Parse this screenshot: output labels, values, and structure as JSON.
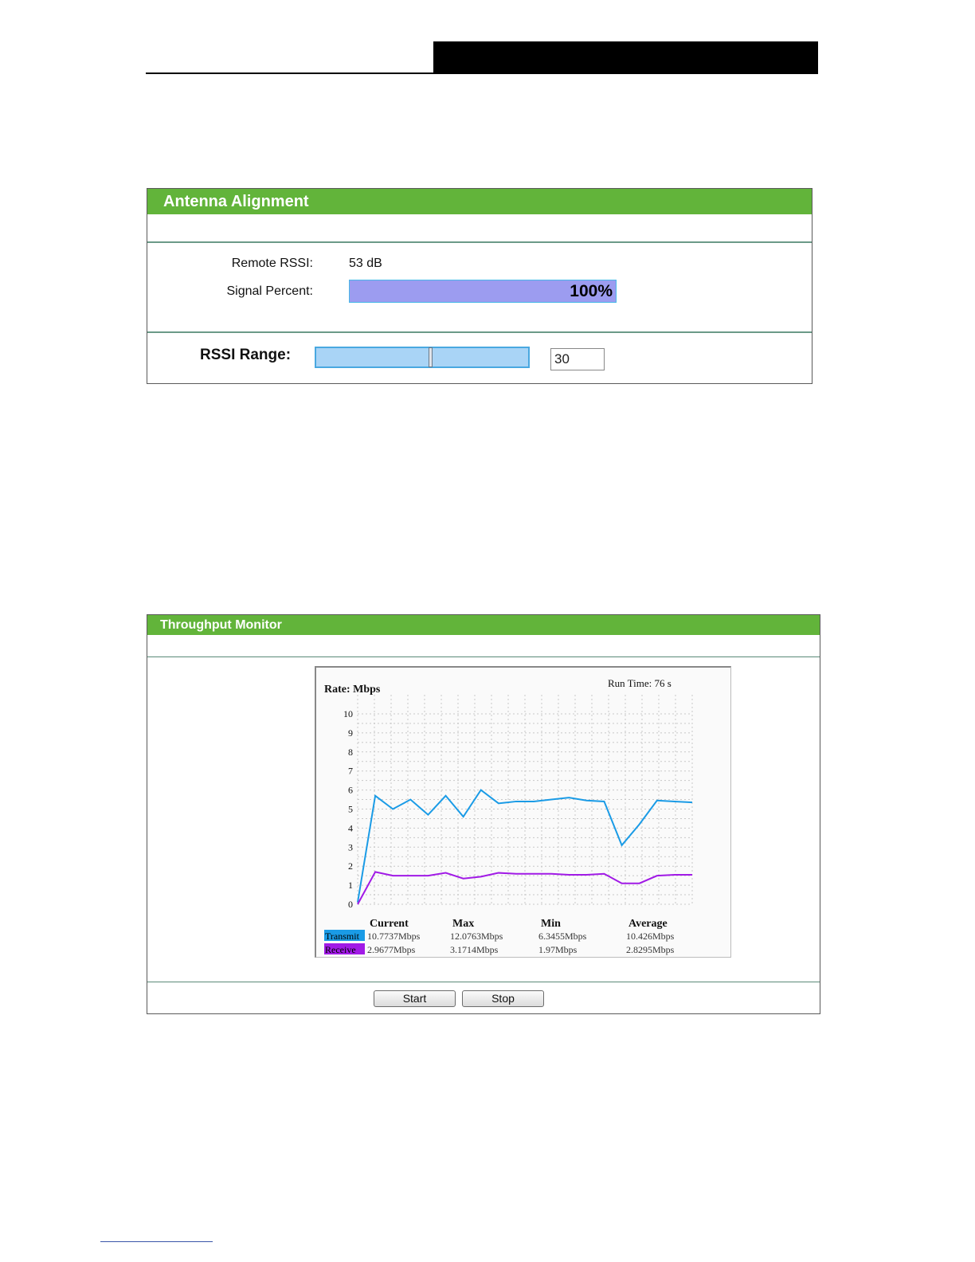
{
  "antenna": {
    "title": "Antenna Alignment",
    "remote_rssi_label": "Remote RSSI:",
    "remote_rssi_value": "53 dB",
    "signal_percent_label": "Signal Percent:",
    "signal_percent_text": "100%",
    "signal_percent_value": 100,
    "rssi_range_label": "RSSI Range:",
    "rssi_range_value": "30",
    "rssi_slider_fraction": 0.54
  },
  "throughput": {
    "title": "Throughput Monitor",
    "start_label": "Start",
    "stop_label": "Stop"
  },
  "chart_data": {
    "type": "line",
    "title": "Rate: Mbps",
    "annotation": "Run Time: 76 s",
    "ylim": [
      0,
      10
    ],
    "y_ticks": [
      "0",
      "1",
      "2",
      "3",
      "4",
      "5",
      "6",
      "7",
      "8",
      "9",
      "10"
    ],
    "grid": true,
    "x": [
      0,
      1,
      2,
      3,
      4,
      5,
      6,
      7,
      8,
      9,
      10,
      11,
      12,
      13,
      14,
      15,
      16,
      17,
      18,
      19
    ],
    "series": [
      {
        "name": "Transmit",
        "color": "#1a9be6",
        "values": [
          0.1,
          5.7,
          5.0,
          5.5,
          4.7,
          5.7,
          4.6,
          6.0,
          5.3,
          5.4,
          5.4,
          5.5,
          5.6,
          5.45,
          5.4,
          3.1,
          4.2,
          5.45,
          5.4,
          5.35
        ]
      },
      {
        "name": "Receive",
        "color": "#a11ae6",
        "values": [
          0.0,
          1.7,
          1.5,
          1.5,
          1.5,
          1.65,
          1.35,
          1.45,
          1.65,
          1.6,
          1.6,
          1.6,
          1.55,
          1.55,
          1.6,
          1.1,
          1.1,
          1.5,
          1.55,
          1.55
        ]
      }
    ],
    "stats": {
      "headers": [
        "Current",
        "Max",
        "Min",
        "Average"
      ],
      "rows": [
        {
          "label": "Transmit",
          "color": "#1a9be6",
          "values": [
            "10.7737Mbps",
            "12.0763Mbps",
            "6.3455Mbps",
            "10.426Mbps"
          ]
        },
        {
          "label": "Receive",
          "color": "#a11ae6",
          "values": [
            "2.9677Mbps",
            "3.1714Mbps",
            "1.97Mbps",
            "2.8295Mbps"
          ]
        }
      ]
    }
  }
}
